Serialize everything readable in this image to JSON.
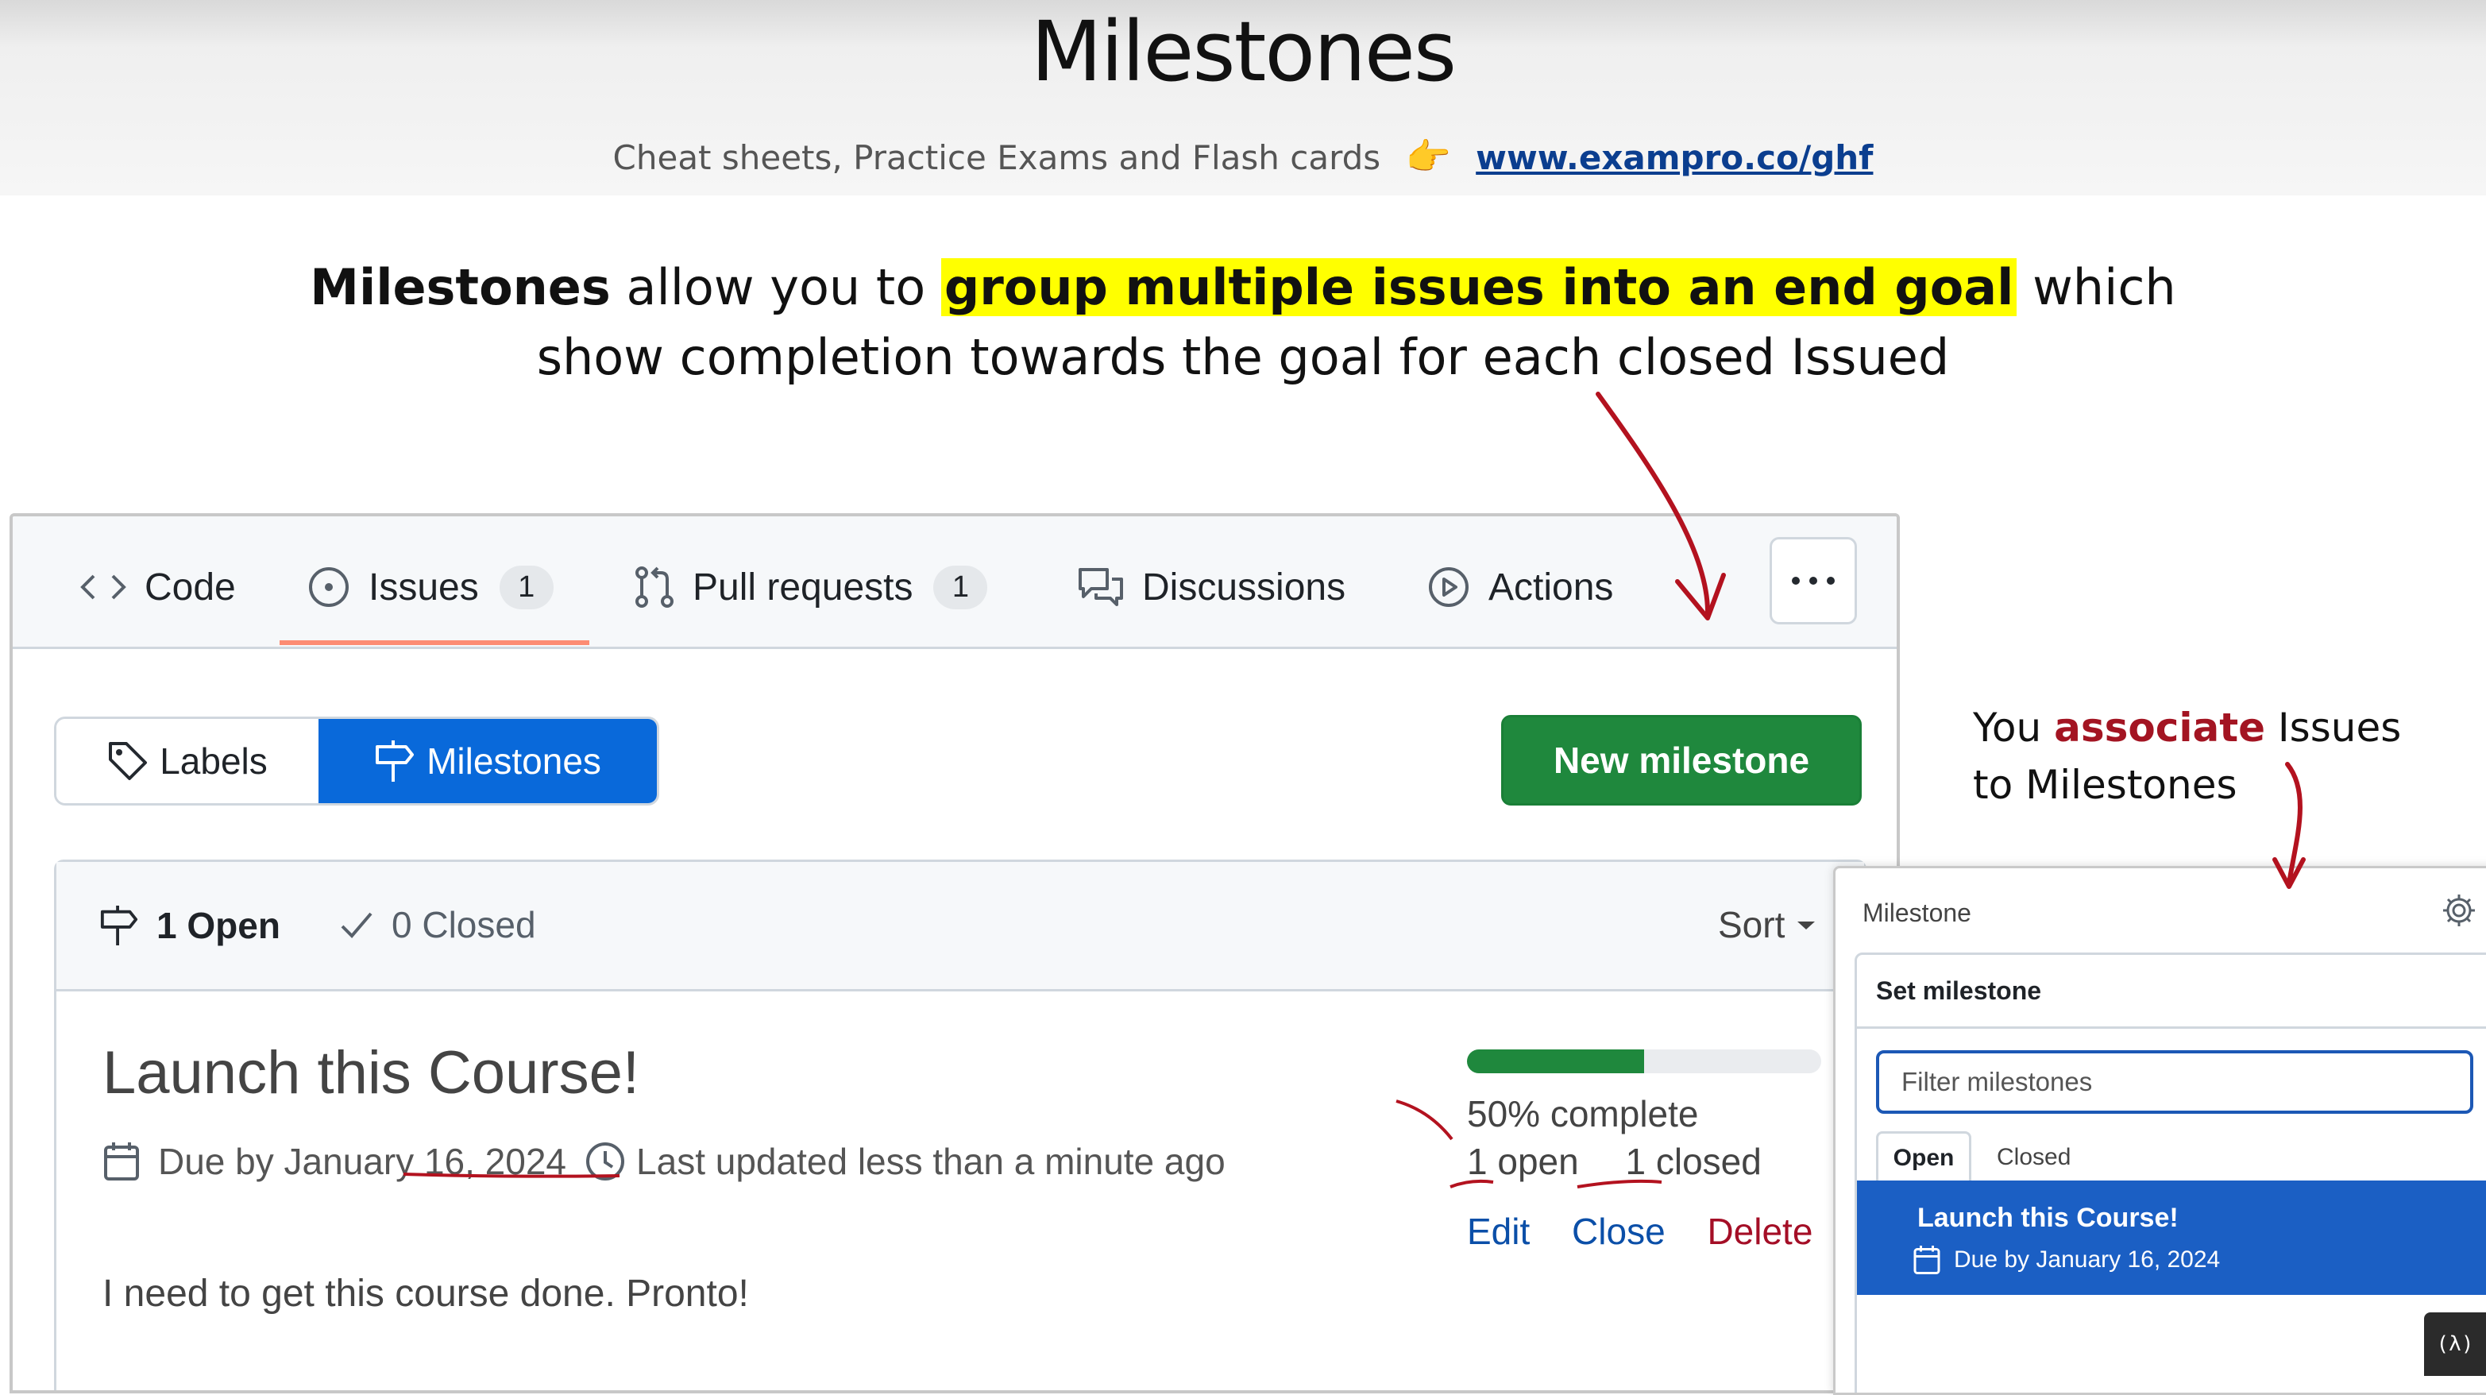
{
  "slide": {
    "title": "Milestones",
    "subtitle": "Cheat sheets, Practice Exams and Flash cards",
    "link": "www.exampro.co/ghf",
    "lead_bold": "Milestones",
    "lead_text1": " allow you to ",
    "lead_highlight": "group multiple issues into an end goal",
    "lead_text2": " which",
    "lead_line2": "show completion towards the goal for each closed Issued",
    "assoc_pre": "You ",
    "assoc_bold": "associate",
    "assoc_post": " Issues",
    "assoc_line2": "to Milestones"
  },
  "repo_tabs": [
    {
      "label": "Code",
      "icon": "code-icon"
    },
    {
      "label": "Issues",
      "count": "1",
      "icon": "issue-icon"
    },
    {
      "label": "Pull requests",
      "count": "1",
      "icon": "pull-request-icon"
    },
    {
      "label": "Discussions",
      "icon": "discussions-icon"
    },
    {
      "label": "Actions",
      "icon": "actions-icon"
    }
  ],
  "toolbar": {
    "labels": "Labels",
    "milestones": "Milestones",
    "new_milestone": "New milestone"
  },
  "list": {
    "open": "1 Open",
    "closed": "0 Closed",
    "sort": "Sort"
  },
  "milestone": {
    "title": "Launch this Course!",
    "due": "Due by January 16, 2024",
    "updated": "Last updated less than a minute ago",
    "description": "I need to get this course done. Pronto!",
    "progress": 0.5,
    "percent": "50% complete",
    "open": "1 open",
    "closed": "1 closed",
    "edit": "Edit",
    "close": "Close",
    "delete": "Delete"
  },
  "sidebar": {
    "label": "Milestone",
    "set_milestone": "Set milestone",
    "filter_placeholder": "Filter milestones",
    "tab_open": "Open",
    "tab_closed": "Closed",
    "item_title": "Launch this Course!",
    "item_due": "Due by January 16, 2024"
  },
  "colors": {
    "accent_blue": "#0969da",
    "green": "#1f883d",
    "highlight": "#ffff00",
    "annotation_red": "#b3121f"
  }
}
